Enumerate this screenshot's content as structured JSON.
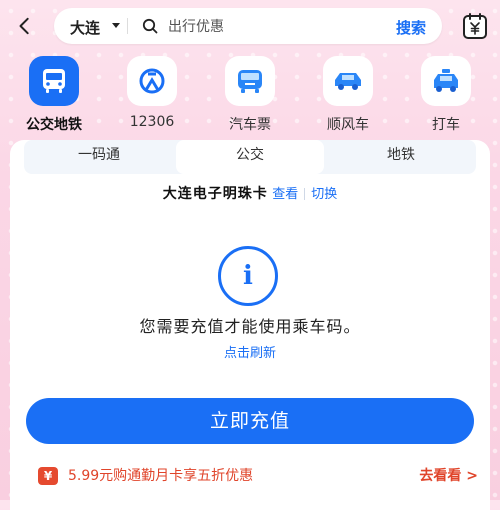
{
  "topbar": {
    "city": "大连",
    "search_placeholder": "出行优惠",
    "search_button": "搜索"
  },
  "categories": [
    {
      "label": "公交地铁",
      "icon": "bus-icon",
      "active": true
    },
    {
      "label": "12306",
      "icon": "train-logo-icon",
      "active": false
    },
    {
      "label": "汽车票",
      "icon": "coach-icon",
      "active": false
    },
    {
      "label": "顺风车",
      "icon": "car-icon",
      "active": false
    },
    {
      "label": "打车",
      "icon": "taxi-icon",
      "active": false
    }
  ],
  "tabs": [
    {
      "label": "一码通",
      "active": false
    },
    {
      "label": "公交",
      "active": true
    },
    {
      "label": "地铁",
      "active": false
    }
  ],
  "card": {
    "name": "大连电子明珠卡",
    "view_link": "查看",
    "switch_link": "切换",
    "info_glyph": "i",
    "message": "您需要充值才能使用乘车码。",
    "refresh": "点击刷新",
    "cta": "立即充值"
  },
  "promo": {
    "icon": "¥",
    "text": "5.99元购通勤月卡享五折优惠",
    "link": "去看看 >"
  },
  "colors": {
    "accent": "#1a6ff5",
    "promo": "#e0452b",
    "background": "#fbd7e6"
  }
}
